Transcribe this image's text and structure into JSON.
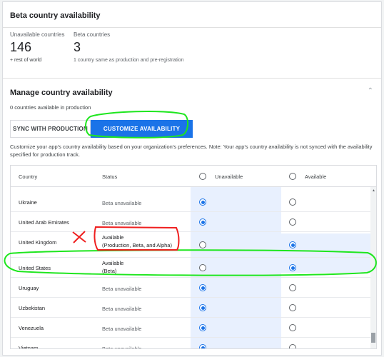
{
  "beta": {
    "title": "Beta country availability",
    "unavailable_label": "Unavailable countries",
    "unavailable_value": "146",
    "unavailable_sub": "+ rest of world",
    "beta_label": "Beta countries",
    "beta_value": "3",
    "beta_sub": "1 country same as production and pre-registration"
  },
  "manage": {
    "title": "Manage country availability",
    "production_count": "0 countries available in production",
    "sync_label": "SYNC WITH PRODUCTION",
    "customize_label": "CUSTOMIZE AVAILABILITY",
    "description": "Customize your app's country availability based on your organization's preferences. Note: Your app's country availability is not synced with the availability specified for production track."
  },
  "table": {
    "headers": {
      "country": "Country",
      "status": "Status",
      "unavailable": "Unavailable",
      "available": "Available"
    },
    "rows": [
      {
        "country": "Ukraine",
        "status": "Beta unavailable",
        "status2": "",
        "selected": "unavailable"
      },
      {
        "country": "United Arab Emirates",
        "status": "Beta unavailable",
        "status2": "",
        "selected": "unavailable"
      },
      {
        "country": "United Kingdom",
        "status": "Available",
        "status2": "(Production, Beta, and Alpha)",
        "selected": "available"
      },
      {
        "country": "United States",
        "status": "Available",
        "status2": "(Beta)",
        "selected": "available"
      },
      {
        "country": "Uruguay",
        "status": "Beta unavailable",
        "status2": "",
        "selected": "unavailable"
      },
      {
        "country": "Uzbekistan",
        "status": "Beta unavailable",
        "status2": "",
        "selected": "unavailable"
      },
      {
        "country": "Venezuela",
        "status": "Beta unavailable",
        "status2": "",
        "selected": "unavailable"
      },
      {
        "country": "Vietnam",
        "status": "Beta unavailable",
        "status2": "",
        "selected": "unavailable"
      }
    ]
  },
  "annotations": {
    "mark_color": "#ef1f1f",
    "highlight_color": "#1ee61e"
  },
  "colors": {
    "accent": "#1a73e8",
    "selected_column": "#e8f0fe"
  }
}
